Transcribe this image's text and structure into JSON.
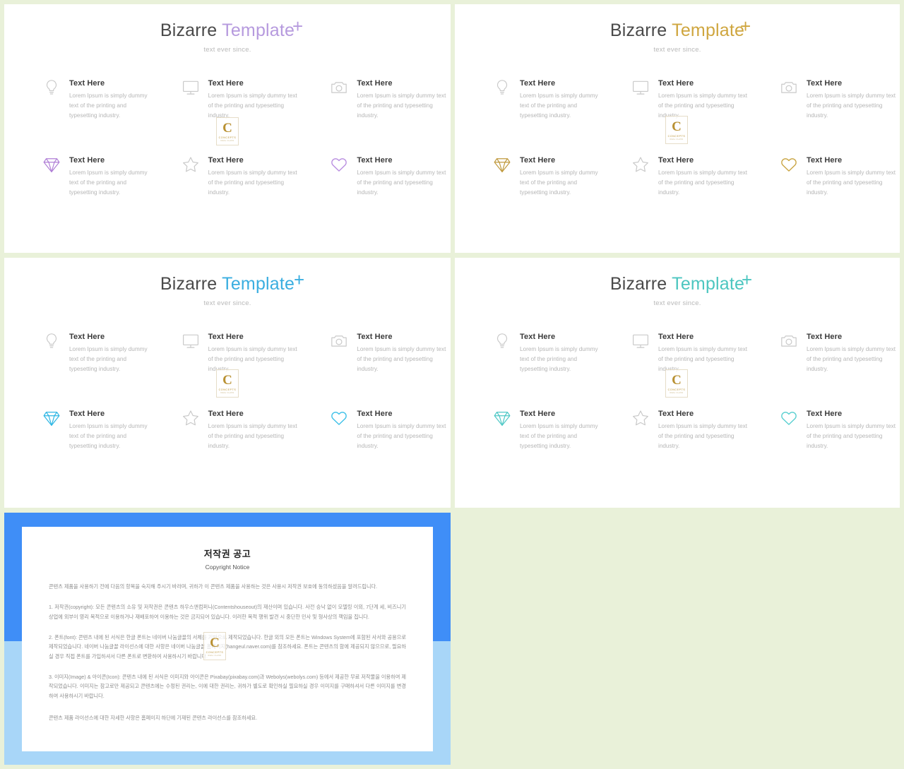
{
  "page": {
    "background_color": "#e9f1d9",
    "body_text": "Lorem Ipsum is simply dummy text of the printing and typesetting industry.",
    "item_title": "Text Here"
  },
  "watermark": {
    "letter": "C",
    "name": "CONCEPTS",
    "sub": "REAL CLASS"
  },
  "slides": [
    {
      "id": "slide-1",
      "title_word1": "Bizarre",
      "title_word2": "Template",
      "subtitle": "text ever since.",
      "plus": "+",
      "accent": "#b69ade",
      "items": [
        {
          "icon": "lightbulb-icon",
          "title": "Text Here",
          "body": "Lorem Ipsum is simply dummy text of the printing and typesetting industry.",
          "color": "#c9c9c9"
        },
        {
          "icon": "monitor-icon",
          "title": "Text Here",
          "body": "Lorem Ipsum is simply dummy text of the printing and typesetting industry.",
          "color": "#c9c9c9"
        },
        {
          "icon": "camera-icon",
          "title": "Text Here",
          "body": "Lorem Ipsum is simply dummy text of the printing and typesetting industry.",
          "color": "#c9c9c9"
        },
        {
          "icon": "diamond-icon",
          "title": "Text Here",
          "body": "Lorem Ipsum is simply dummy text of the printing and typesetting industry.",
          "color": "#b07fd6"
        },
        {
          "icon": "star-icon",
          "title": "Text Here",
          "body": "Lorem Ipsum is simply dummy text of the printing and typesetting industry.",
          "color": "#c9c9c9"
        },
        {
          "icon": "heart-icon",
          "title": "Text Here",
          "body": "Lorem Ipsum is simply dummy text of the printing and typesetting industry.",
          "color": "#b98ee0"
        }
      ]
    },
    {
      "id": "slide-2",
      "title_word1": "Bizarre",
      "title_word2": "Template",
      "subtitle": "text ever since.",
      "plus": "+",
      "accent": "#cfa63f",
      "items": [
        {
          "icon": "lightbulb-icon",
          "title": "Text Here",
          "body": "Lorem Ipsum is simply dummy text of the printing and typesetting industry.",
          "color": "#c9c9c9"
        },
        {
          "icon": "monitor-icon",
          "title": "Text Here",
          "body": "Lorem Ipsum is simply dummy text of the printing and typesetting industry.",
          "color": "#c9c9c9"
        },
        {
          "icon": "camera-icon",
          "title": "Text Here",
          "body": "Lorem Ipsum is simply dummy text of the printing and typesetting industry.",
          "color": "#c9c9c9"
        },
        {
          "icon": "diamond-icon",
          "title": "Text Here",
          "body": "Lorem Ipsum is simply dummy text of the printing and typesetting industry.",
          "color": "#c09a3e"
        },
        {
          "icon": "star-icon",
          "title": "Text Here",
          "body": "Lorem Ipsum is simply dummy text of the printing and typesetting industry.",
          "color": "#c9c9c9"
        },
        {
          "icon": "heart-icon",
          "title": "Text Here",
          "body": "Lorem Ipsum is simply dummy text of the printing and typesetting industry.",
          "color": "#c9a442"
        }
      ]
    },
    {
      "id": "slide-3",
      "title_word1": "Bizarre",
      "title_word2": "Template",
      "subtitle": "text ever since.",
      "plus": "+",
      "accent": "#3aaee0",
      "items": [
        {
          "icon": "lightbulb-icon",
          "title": "Text Here",
          "body": "Lorem Ipsum is simply dummy text of the printing and typesetting industry.",
          "color": "#c9c9c9"
        },
        {
          "icon": "monitor-icon",
          "title": "Text Here",
          "body": "Lorem Ipsum is simply dummy text of the printing and typesetting industry.",
          "color": "#c9c9c9"
        },
        {
          "icon": "camera-icon",
          "title": "Text Here",
          "body": "Lorem Ipsum is simply dummy text of the printing and typesetting industry.",
          "color": "#c9c9c9"
        },
        {
          "icon": "diamond-icon",
          "title": "Text Here",
          "body": "Lorem Ipsum is simply dummy text of the printing and typesetting industry.",
          "color": "#2cb6e4"
        },
        {
          "icon": "star-icon",
          "title": "Text Here",
          "body": "Lorem Ipsum is simply dummy text of the printing and typesetting industry.",
          "color": "#c9c9c9"
        },
        {
          "icon": "heart-icon",
          "title": "Text Here",
          "body": "Lorem Ipsum is simply dummy text of the printing and typesetting industry.",
          "color": "#3cc0e8"
        }
      ]
    },
    {
      "id": "slide-4",
      "title_word1": "Bizarre",
      "title_word2": "Template",
      "subtitle": "text ever since.",
      "plus": "+",
      "accent": "#4cc6c0",
      "items": [
        {
          "icon": "lightbulb-icon",
          "title": "Text Here",
          "body": "Lorem Ipsum is simply dummy text of the printing and typesetting industry.",
          "color": "#c9c9c9"
        },
        {
          "icon": "monitor-icon",
          "title": "Text Here",
          "body": "Lorem Ipsum is simply dummy text of the printing and typesetting industry.",
          "color": "#c9c9c9"
        },
        {
          "icon": "camera-icon",
          "title": "Text Here",
          "body": "Lorem Ipsum is simply dummy text of the printing and typesetting industry.",
          "color": "#c9c9c9"
        },
        {
          "icon": "diamond-icon",
          "title": "Text Here",
          "body": "Lorem Ipsum is simply dummy text of the printing and typesetting industry.",
          "color": "#4ec8c6"
        },
        {
          "icon": "star-icon",
          "title": "Text Here",
          "body": "Lorem Ipsum is simply dummy text of the printing and typesetting industry.",
          "color": "#c9c9c9"
        },
        {
          "icon": "heart-icon",
          "title": "Text Here",
          "body": "Lorem Ipsum is simply dummy text of the printing and typesetting industry.",
          "color": "#58cfd0"
        }
      ]
    }
  ],
  "copyright_slide": {
    "frame_color": "#3f8ef7",
    "lower_color": "#a8d6f8",
    "title": "저작권 공고",
    "subtitle": "Copyright Notice",
    "intro": "콘텐츠 제품을 사용하기 전에 다음의 항목을 숙지해 주시기 바라며, 귀하가 이 콘텐츠 제품을 사용하는 것은 사용시 저작권 보호에 동의하셨음을 알려드립니다.",
    "sections": [
      "1. 저작권(copyright): 모든 콘텐츠의 소유 및 저작권은 콘텐츠 하우스앤컴퍼니(Contentshouseout)의 재산이며 있습니다. 사전 승낙 없이 모델링 이외, 7단계 세, 비즈니기 상업에 외부이 영리 목적으로 이용하거나 재배포하여 이용하는 것은 금지되어 있습니다. 이러한 목적 행위 발견 시 중단한 민사 및 형사상의 책임을 집니다.",
      "2. 폰트(font): 콘텐츠 내에 된 서식은 한글 폰트는 네이버 나눔글꼴의 서체를 기반으로 제작되었습니다. 한글 외의 모든 폰트는 Windows System에 포함된 사서와 공용으로 제작되었습니다. 네이버 나눔글꼴 라이선스에 대한 사항은 네이버 나눔글꼴 홈페이지(hangeul.naver.com)를 참조하세요. 폰트는 콘텐츠의 함에 제공되지 않으므로, 필요하실 경우 직접 폰트를 가입하셔서 다른 폰트로 변환하여 사용하시기 바랍니다.",
      "3. 이미지(Image) & 아이콘(Icon): 콘텐츠 내에 된 서식은 이미지와 아이콘은 Pixabay(pixabay.com)과 Webolys(webolys.com) 등에서 제공한 무료 저작물을 이용하여 제작되었습니다. 이미지는 참고로만 제공되고 콘텐츠에는 수정된 권리는, 이에 대한 권리는, 귀하가 별도로 확인하실 필요하실 경우 이미지를 구매하셔서 다른 이미지를 변경하여 사용하시기 바랍니다."
    ],
    "closing": "콘텐츠 제품 라이선스에 대한 자세한 사항은 홈페이지 하단에 기재된 콘텐츠 라이선스를 참조하세요."
  }
}
